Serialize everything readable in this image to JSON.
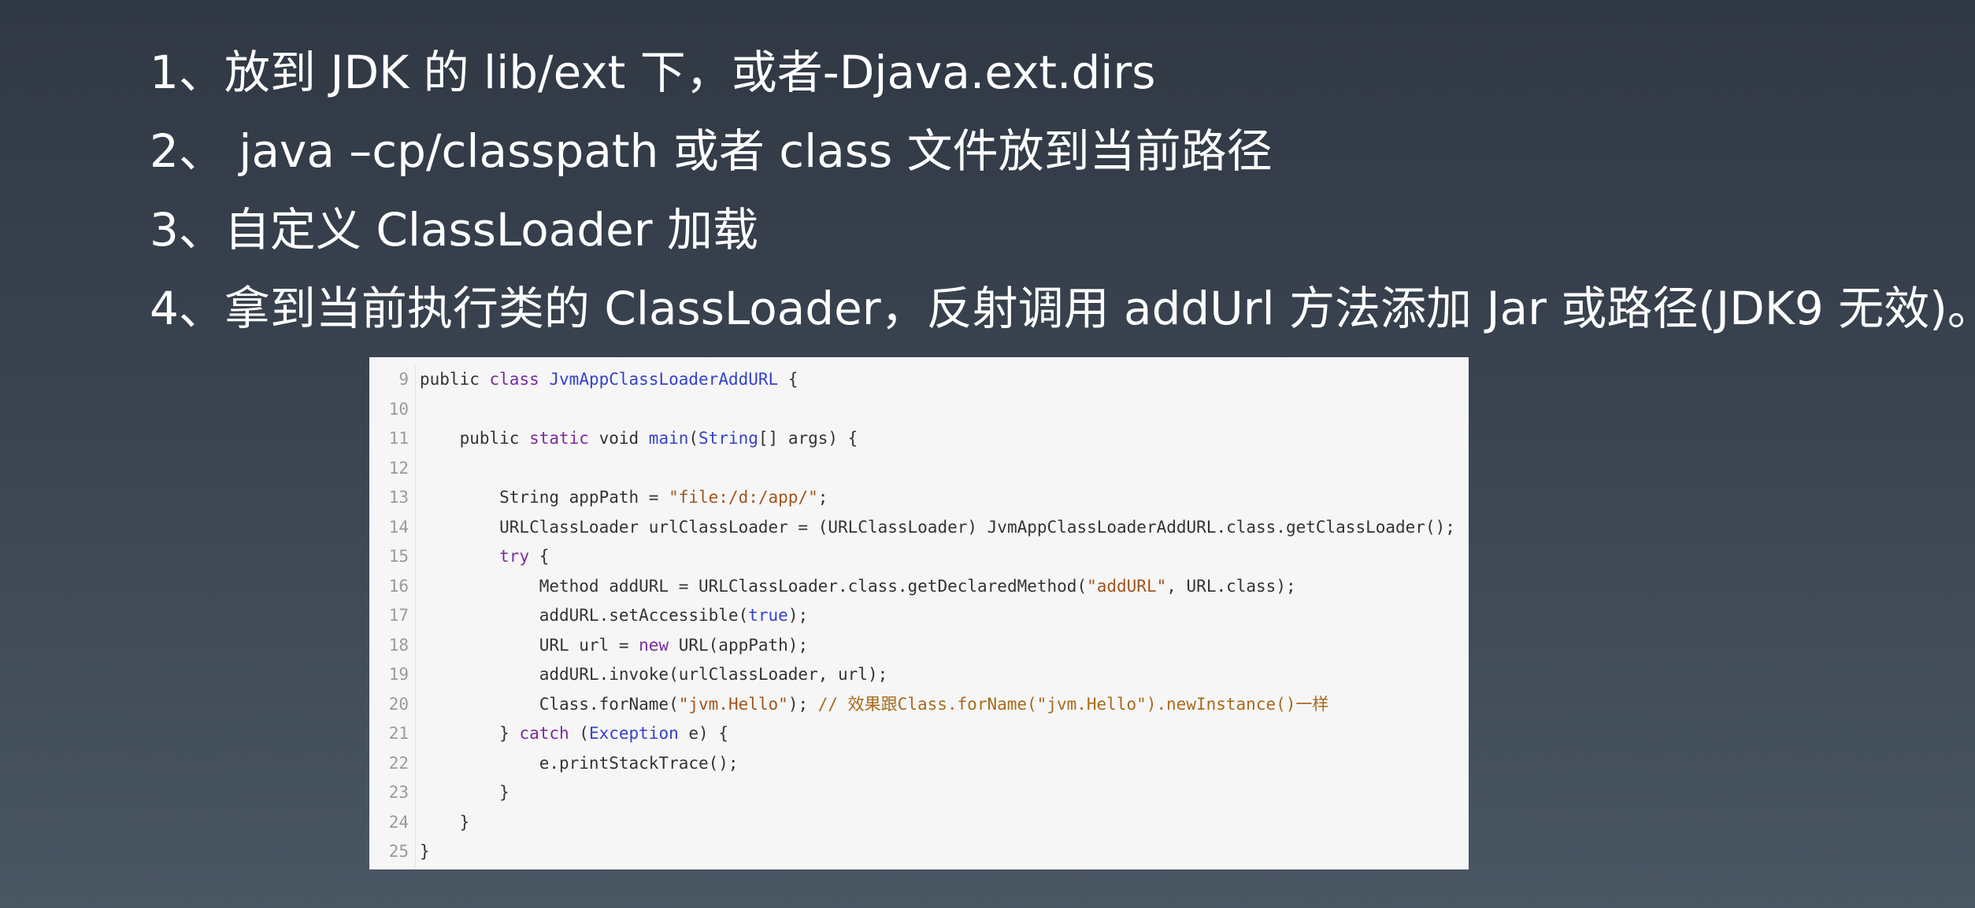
{
  "slide": {
    "bullets": [
      "1、放到 JDK 的 lib/ext 下，或者-Djava.ext.dirs",
      "2、 java –cp/classpath 或者 class 文件放到当前路径",
      "3、自定义 ClassLoader 加载",
      "4、拿到当前执行类的 ClassLoader，反射调用 addUrl 方法添加 Jar 或路径(JDK9 无效)。"
    ]
  },
  "code": {
    "colors": {
      "keyword": "#7a2b9c",
      "type": "#3342c8",
      "string": "#a2541d",
      "comment": "#a86a1a",
      "plain": "#333333",
      "line_number": "#9a9a9a",
      "background": "#f6f6f6"
    },
    "lines": [
      {
        "num": "9",
        "tokens": [
          {
            "t": "pl",
            "v": "public "
          },
          {
            "t": "kw",
            "v": "class"
          },
          {
            "t": "pl",
            "v": " "
          },
          {
            "t": "typ",
            "v": "JvmAppClassLoaderAddURL"
          },
          {
            "t": "pl",
            "v": " {"
          }
        ]
      },
      {
        "num": "10",
        "tokens": []
      },
      {
        "num": "11",
        "tokens": [
          {
            "t": "pl",
            "v": "    public "
          },
          {
            "t": "kw",
            "v": "static"
          },
          {
            "t": "pl",
            "v": " void "
          },
          {
            "t": "typ",
            "v": "main"
          },
          {
            "t": "pl",
            "v": "("
          },
          {
            "t": "typ",
            "v": "String"
          },
          {
            "t": "pl",
            "v": "[] args) {"
          }
        ]
      },
      {
        "num": "12",
        "tokens": []
      },
      {
        "num": "13",
        "tokens": [
          {
            "t": "pl",
            "v": "        String appPath = "
          },
          {
            "t": "str",
            "v": "\"file:/d:/app/\""
          },
          {
            "t": "pl",
            "v": ";"
          }
        ]
      },
      {
        "num": "14",
        "tokens": [
          {
            "t": "pl",
            "v": "        URLClassLoader urlClassLoader = (URLClassLoader) JvmAppClassLoaderAddURL.class.getClassLoader();"
          }
        ]
      },
      {
        "num": "15",
        "tokens": [
          {
            "t": "pl",
            "v": "        "
          },
          {
            "t": "kw",
            "v": "try"
          },
          {
            "t": "pl",
            "v": " {"
          }
        ]
      },
      {
        "num": "16",
        "tokens": [
          {
            "t": "pl",
            "v": "            Method addURL = URLClassLoader.class.getDeclaredMethod("
          },
          {
            "t": "str",
            "v": "\"addURL\""
          },
          {
            "t": "pl",
            "v": ", URL.class);"
          }
        ]
      },
      {
        "num": "17",
        "tokens": [
          {
            "t": "pl",
            "v": "            addURL.setAccessible("
          },
          {
            "t": "typ",
            "v": "true"
          },
          {
            "t": "pl",
            "v": ");"
          }
        ]
      },
      {
        "num": "18",
        "tokens": [
          {
            "t": "pl",
            "v": "            URL url = "
          },
          {
            "t": "kw",
            "v": "new"
          },
          {
            "t": "pl",
            "v": " URL(appPath);"
          }
        ]
      },
      {
        "num": "19",
        "tokens": [
          {
            "t": "pl",
            "v": "            addURL.invoke(urlClassLoader, url);"
          }
        ]
      },
      {
        "num": "20",
        "tokens": [
          {
            "t": "pl",
            "v": "            Class.forName("
          },
          {
            "t": "str",
            "v": "\"jvm.Hello\""
          },
          {
            "t": "pl",
            "v": "); "
          },
          {
            "t": "com",
            "v": "// 效果跟Class.forName(\"jvm.Hello\").newInstance()一样"
          }
        ]
      },
      {
        "num": "21",
        "tokens": [
          {
            "t": "pl",
            "v": "        } "
          },
          {
            "t": "kw",
            "v": "catch"
          },
          {
            "t": "pl",
            "v": " ("
          },
          {
            "t": "typ",
            "v": "Exception"
          },
          {
            "t": "pl",
            "v": " e) {"
          }
        ]
      },
      {
        "num": "22",
        "tokens": [
          {
            "t": "pl",
            "v": "            e.printStackTrace();"
          }
        ]
      },
      {
        "num": "23",
        "tokens": [
          {
            "t": "pl",
            "v": "        }"
          }
        ]
      },
      {
        "num": "24",
        "tokens": [
          {
            "t": "pl",
            "v": "    }"
          }
        ]
      },
      {
        "num": "25",
        "tokens": [
          {
            "t": "pl",
            "v": "}"
          }
        ]
      }
    ]
  }
}
